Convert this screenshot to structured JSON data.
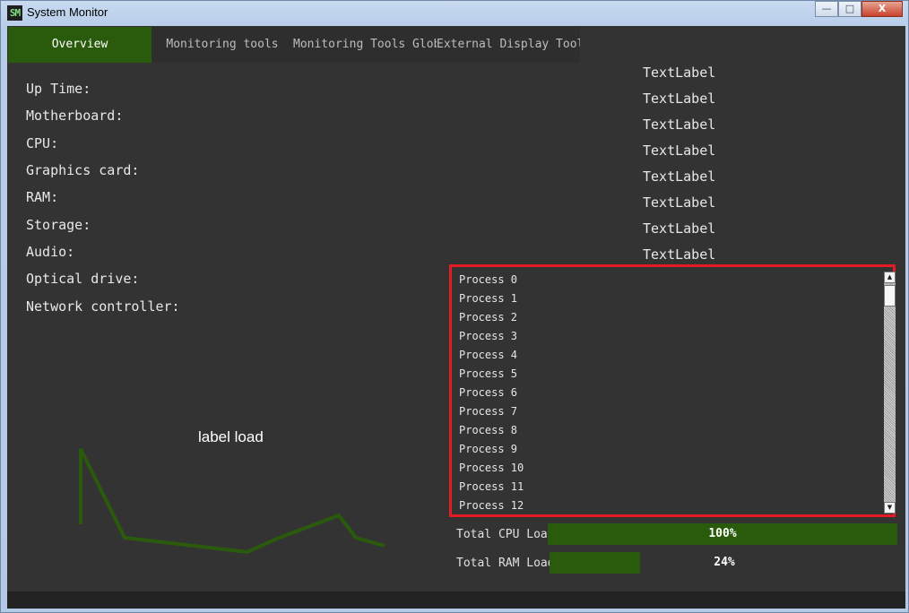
{
  "window": {
    "title": "System Monitor",
    "icon_text": "SM",
    "buttons": {
      "minimize": "—",
      "maximize": "□",
      "close": "X"
    }
  },
  "tabs": [
    {
      "label": "Overview",
      "active": true
    },
    {
      "label": "Monitoring tools",
      "active": false
    },
    {
      "label": "Monitoring Tools Global",
      "active": false
    },
    {
      "label": "External Display Tools",
      "active": false
    }
  ],
  "info_labels": [
    "Up Time:",
    "Motherboard:",
    "CPU:",
    "Graphics card:",
    "RAM:",
    "Storage:",
    "Audio:",
    "Optical drive:",
    "Network controller:"
  ],
  "value_labels": [
    "TextLabel",
    "TextLabel",
    "TextLabel",
    "TextLabel",
    "TextLabel",
    "TextLabel",
    "TextLabel",
    "TextLabel"
  ],
  "load": {
    "title": "label load",
    "color": "#2a5a0c"
  },
  "processes": [
    "Process 0",
    "Process 1",
    "Process 2",
    "Process 3",
    "Process 4",
    "Process 5",
    "Process 6",
    "Process 7",
    "Process 8",
    "Process 9",
    "Process 10",
    "Process 11",
    "Process 12"
  ],
  "totals": {
    "cpu": {
      "label": "Total CPU Load",
      "text": "100%",
      "fraction": 1.0
    },
    "ram": {
      "label": "Total RAM Load",
      "text": "24%",
      "fraction": 0.26
    }
  },
  "colors": {
    "accent": "#2a5a0c",
    "highlight": "#e31b23",
    "background": "#333333"
  }
}
